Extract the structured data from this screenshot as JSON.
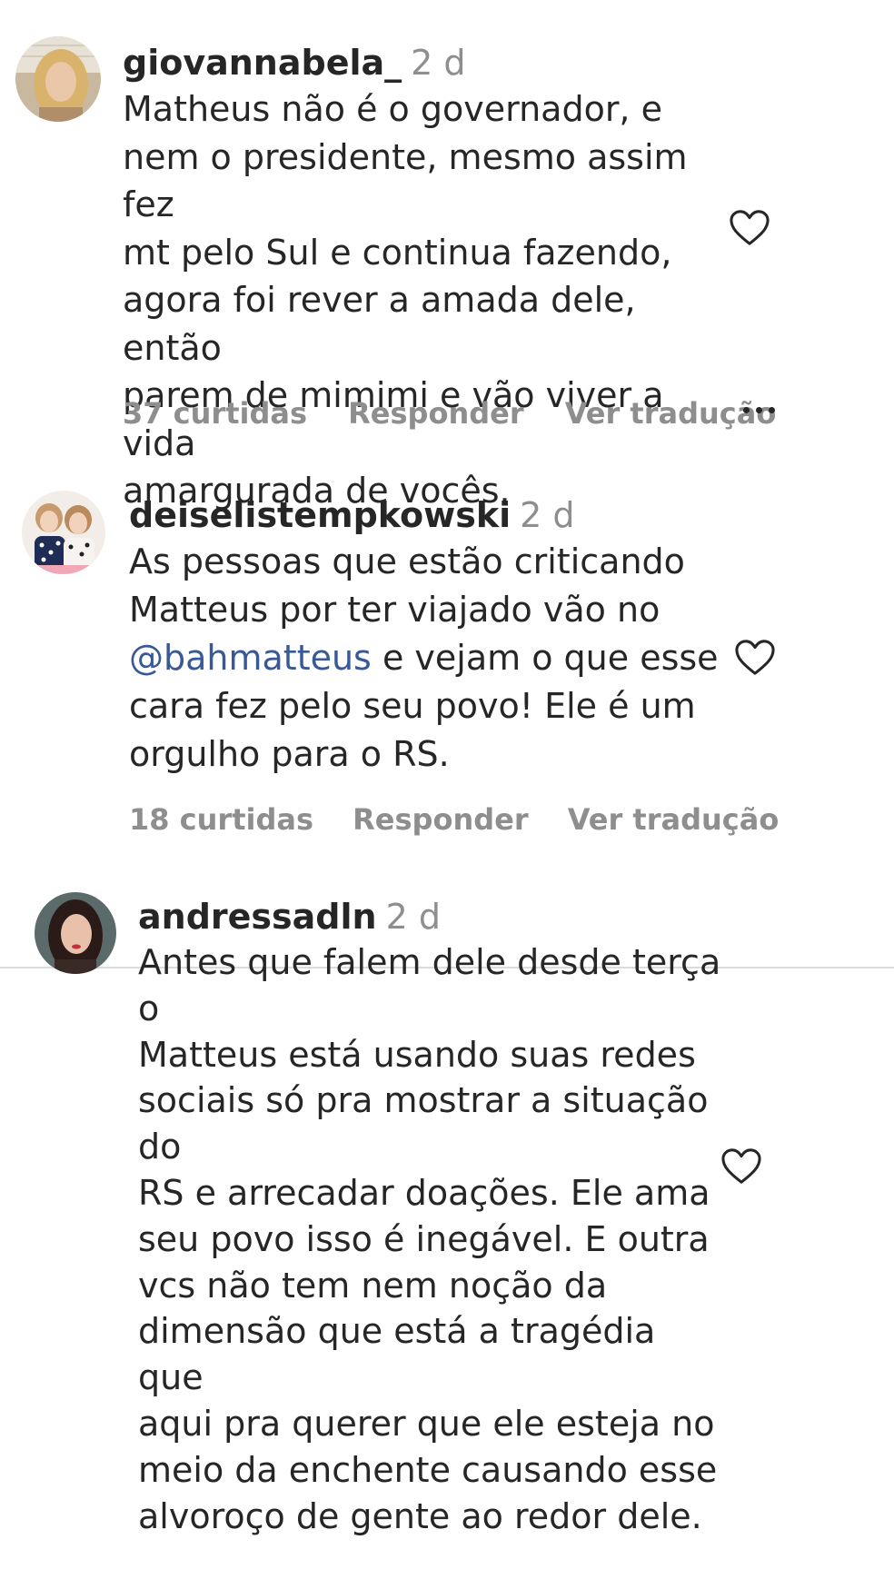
{
  "comments": [
    {
      "username": "giovannabela_",
      "time": "2 d",
      "lines": [
        "Matheus não é o governador, e",
        "nem o presidente, mesmo assim fez",
        "mt pelo Sul e continua fazendo,",
        "agora foi rever a amada dele, então",
        "parem de mimimi e vão viver a vida",
        "amargurada de vocês."
      ],
      "likes": "37 curtidas",
      "reply": "Responder",
      "translate": "Ver tradução"
    },
    {
      "username": "deiselistempkowski",
      "time": "2 d",
      "line1": "As pessoas que estão criticando",
      "line2": "Matteus por ter viajado vão no",
      "mention": "@bahmatteus",
      "line3_rest": " e vejam o que esse",
      "line4": "cara fez pelo seu povo! Ele é um",
      "line5": "orgulho para o RS.",
      "likes": "18 curtidas",
      "reply": "Responder",
      "translate": "Ver tradução"
    },
    {
      "username": "andressadln",
      "time": "2 d",
      "lines": [
        "Antes que falem dele desde terça o",
        "Matteus está usando suas redes",
        "sociais só pra mostrar a situação do",
        "RS e arrecadar doações. Ele ama",
        "seu povo isso é inegável. E outra",
        "vcs não tem nem noção da",
        "dimensão que está a tragédia que",
        "aqui pra querer que ele esteja no",
        "meio da enchente causando esse",
        "alvoroço de gente ao redor dele."
      ]
    }
  ],
  "colors": {
    "text": "#262626",
    "muted": "#8e8e8e",
    "mention": "#385898",
    "divider": "#dbdbdb"
  },
  "icons": {
    "like": "heart-outline-icon",
    "options": "more-horizontal-icon"
  }
}
